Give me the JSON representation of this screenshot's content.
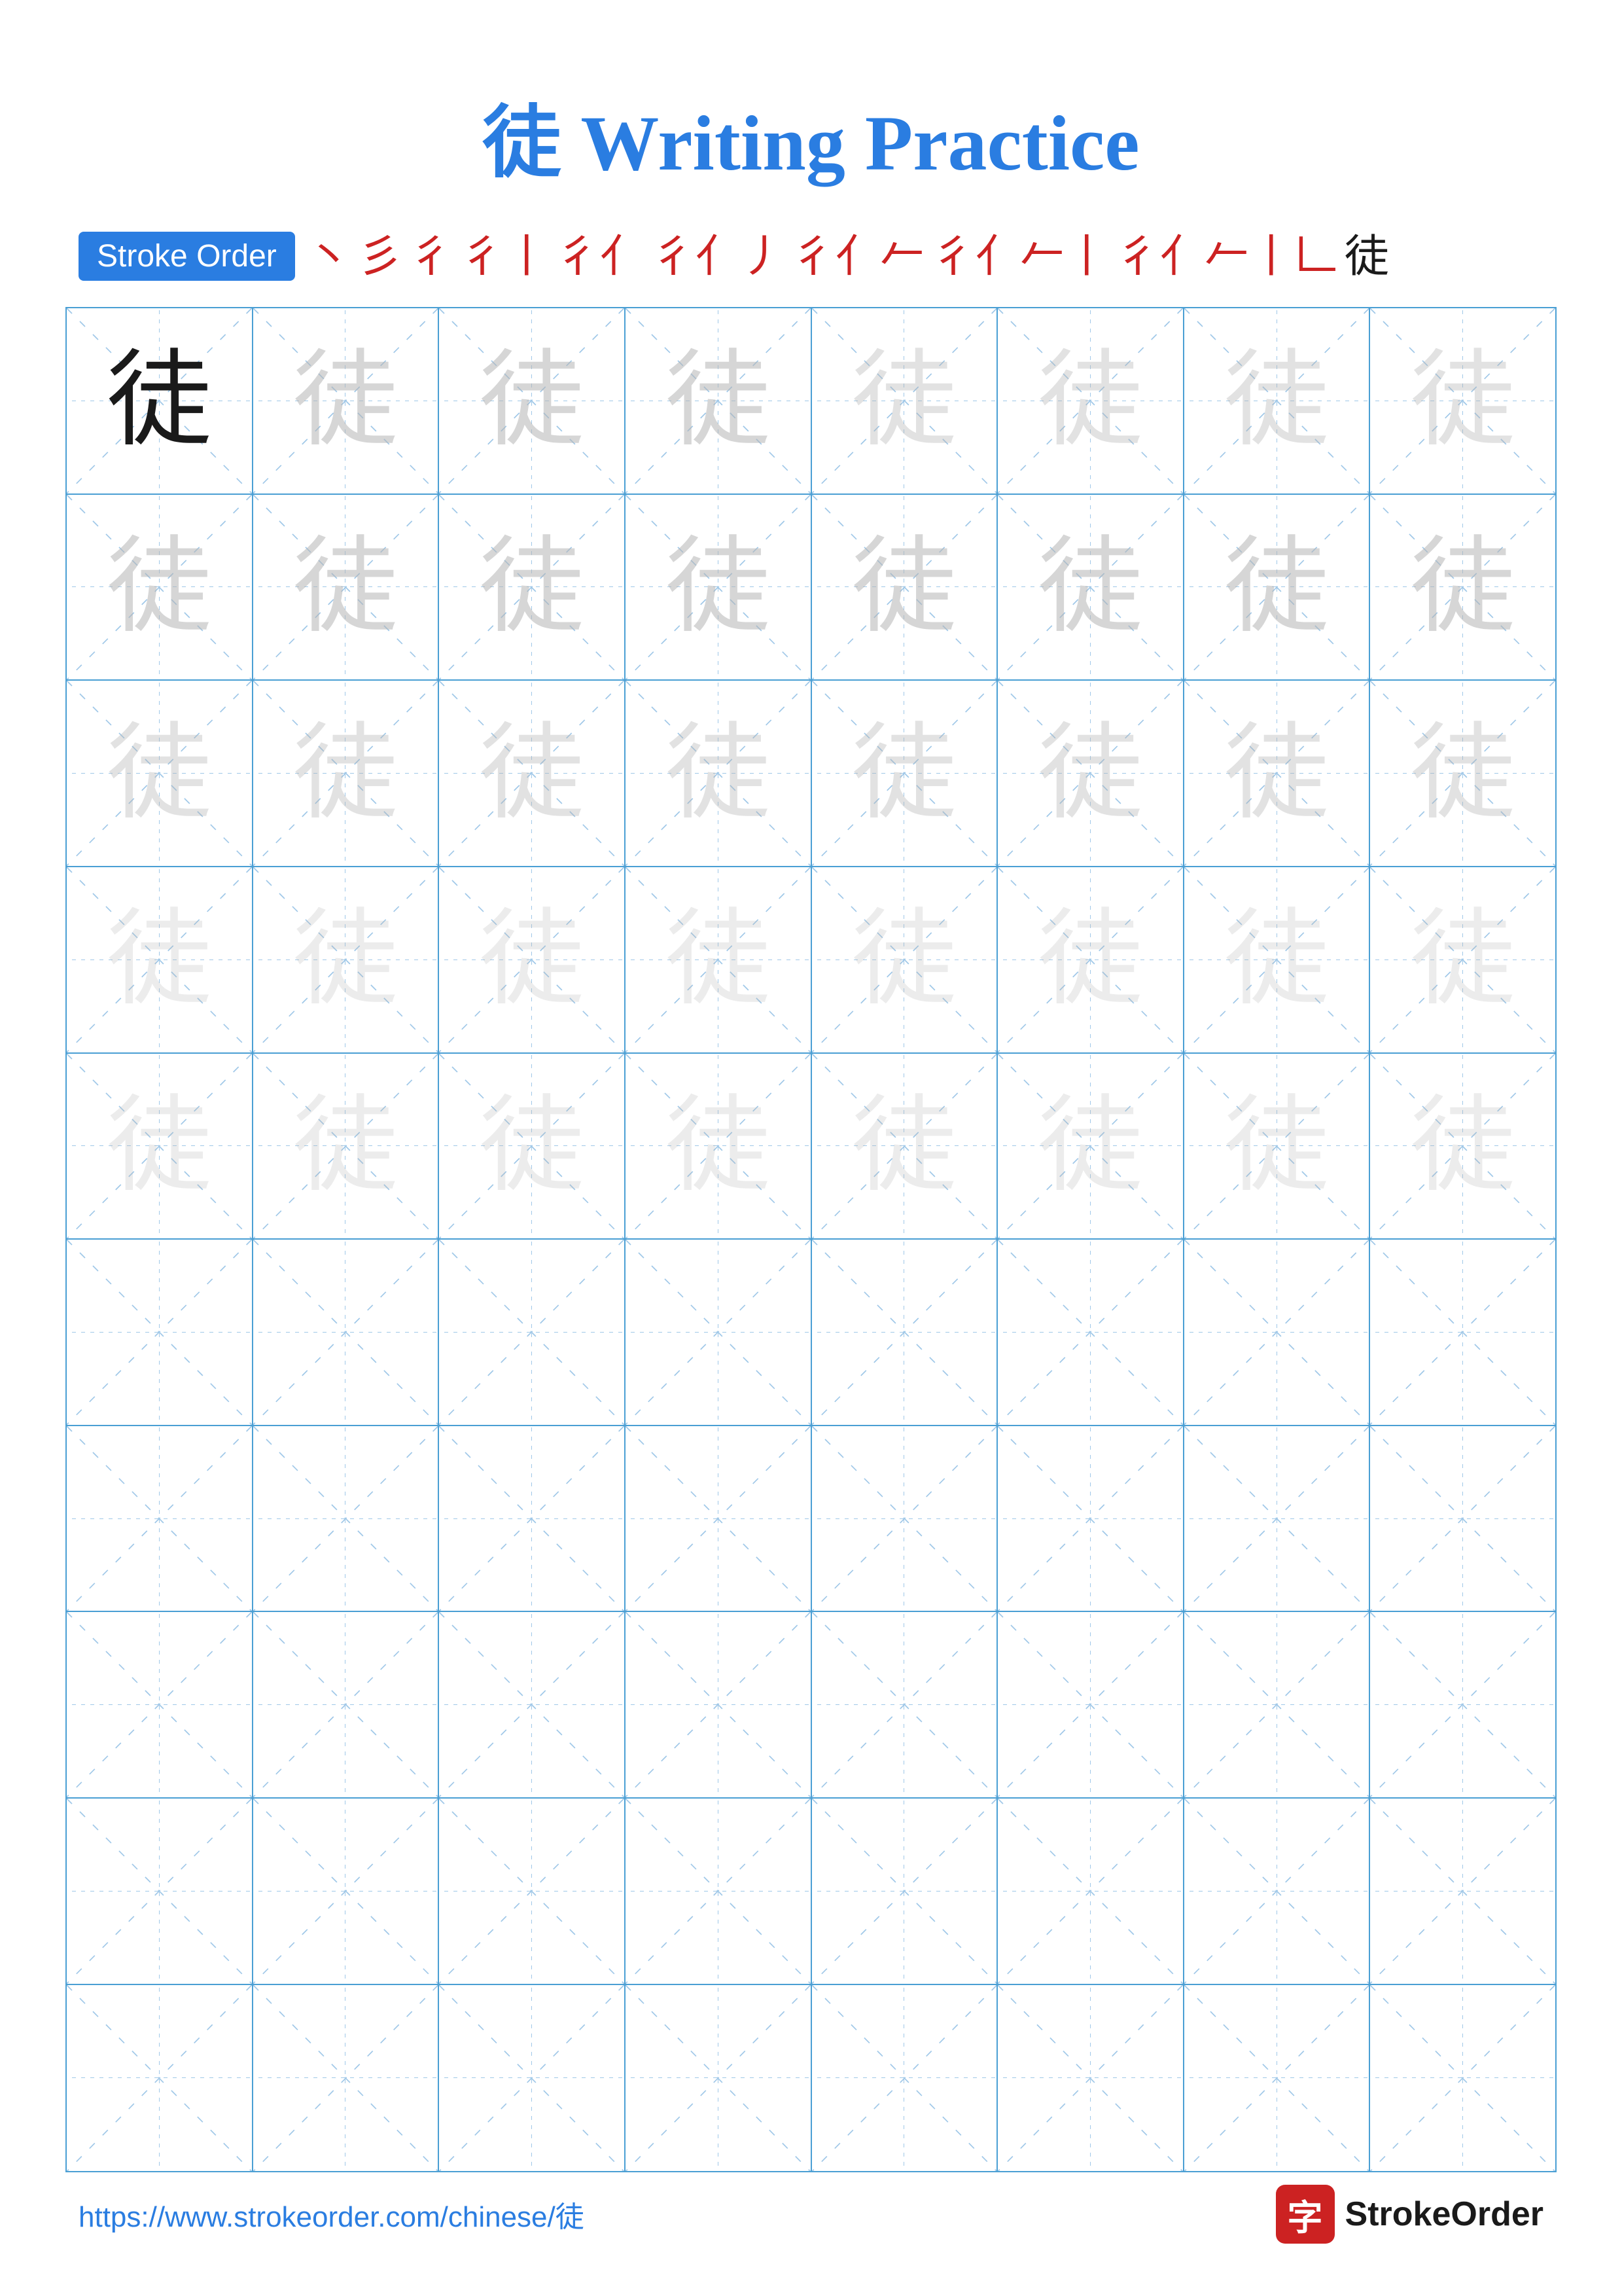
{
  "title": "徒 Writing Practice",
  "stroke_order": {
    "badge_label": "Stroke Order",
    "strokes": [
      "丶",
      "彡",
      "彳",
      "彳丨",
      "彳亻",
      "彳亻丿",
      "彳亻𠂉",
      "彳亻𠂉丨",
      "彳亻𠂉丿丨",
      "彳亻𠂉丿丨𠃊",
      "徒"
    ]
  },
  "character": "徒",
  "grid": {
    "rows": 10,
    "cols": 8
  },
  "footer": {
    "url": "https://www.strokeorder.com/chinese/徒",
    "brand_char": "字",
    "brand_name": "StrokeOrder"
  }
}
